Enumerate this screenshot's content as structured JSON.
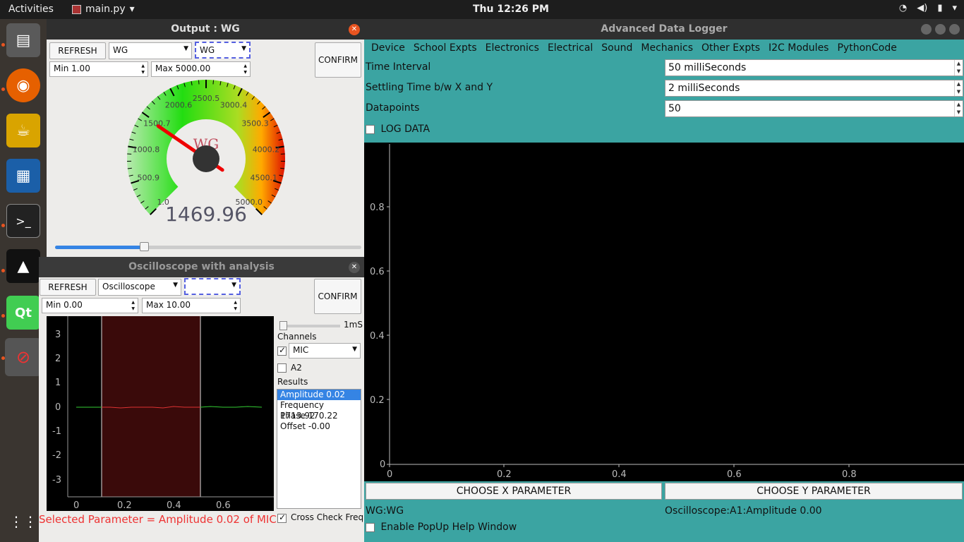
{
  "topbar": {
    "activities": "Activities",
    "app_name": "main.py",
    "clock": "Thu 12:26 PM"
  },
  "main_window": {
    "title": "Advanced Data Logger",
    "menu": [
      "Device",
      "School Expts",
      "Electronics",
      "Electrical",
      "Sound",
      "Mechanics",
      "Other Expts",
      "I2C Modules",
      "PythonCode"
    ],
    "time_interval_label": "Time Interval",
    "time_interval_value": "50 milliSeconds",
    "settling_label": "Settling Time b/w X and Y",
    "settling_value": "2 milliSeconds",
    "datapoints_label": "Datapoints",
    "datapoints_value": "50",
    "log_data_label": "LOG DATA",
    "plot_y_ticks": [
      "0.8",
      "0.6",
      "0.4",
      "0.2",
      "0"
    ],
    "plot_x_ticks": [
      "0",
      "0.2",
      "0.4",
      "0.6",
      "0.8"
    ],
    "choose_x": "CHOOSE X PARAMETER",
    "choose_y": "CHOOSE Y PARAMETER",
    "x_param": "WG:WG",
    "y_param": "Oscilloscope:A1:Amplitude 0.00",
    "popup_help": "Enable PopUp Help Window"
  },
  "wg_window": {
    "title": "Output : WG",
    "refresh": "REFRESH",
    "device": "WG",
    "channel": "WG",
    "confirm": "CONFIRM",
    "min": "Min 1.00",
    "max": "Max 5000.00",
    "gauge_label": "WG",
    "gauge_value": "1469.96",
    "gauge_ticks": [
      "1.0",
      "500.9",
      "1000.8",
      "1500.7",
      "2000.6",
      "2500.5",
      "3000.4",
      "3500.3",
      "4000.2",
      "4500.1",
      "5000.0"
    ],
    "gauge_min": 1.0,
    "gauge_max": 5000.0,
    "gauge_reading": 1469.96,
    "slider_fraction": 0.29
  },
  "osc_window": {
    "title": "Oscilloscope with analysis",
    "refresh": "REFRESH",
    "device": "Oscilloscope",
    "confirm": "CONFIRM",
    "min": "Min 0.00",
    "max": "Max 10.00",
    "timebase": "1mS",
    "channels_label": "Channels",
    "channel1": "MIC",
    "channel2": "A2",
    "results_label": "Results",
    "results": [
      "Amplitude 0.02",
      "Frequency 1713.92",
      "Phase 170.22",
      "Offset -0.00"
    ],
    "cross_check": "Cross Check Freq",
    "selected_param": "Selected Parameter = Amplitude 0.02 of MIC",
    "y_ticks": [
      "3",
      "2",
      "1",
      "0",
      "-1",
      "-2",
      "-3"
    ],
    "x_ticks": [
      "0",
      "0.2",
      "0.4",
      "0.6"
    ]
  }
}
